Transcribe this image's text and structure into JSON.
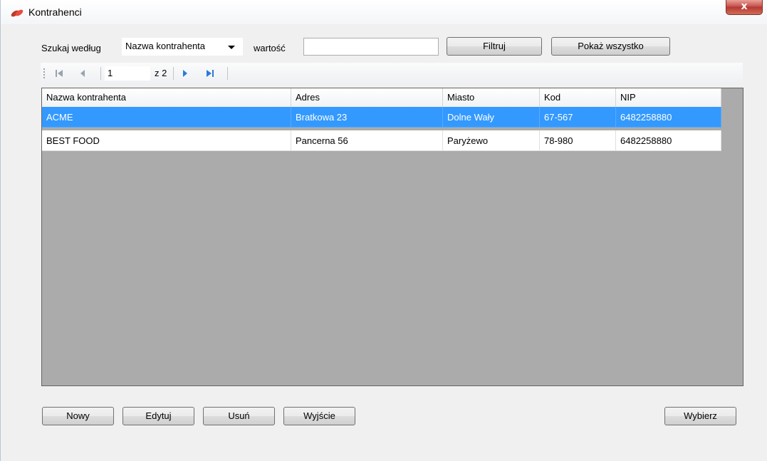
{
  "window": {
    "title": "Kontrahenci",
    "close_glyph": "x"
  },
  "search": {
    "label": "Szukaj według",
    "field_selected": "Nazwa kontrahenta",
    "value_label": "wartość",
    "value": "",
    "filter_button": "Filtruj",
    "show_all_button": "Pokaż wszystko"
  },
  "navigator": {
    "position": "1",
    "count_text": "z 2",
    "icons": [
      "move-first-icon",
      "move-previous-icon",
      "move-next-icon",
      "move-last-icon"
    ]
  },
  "grid": {
    "columns": [
      "Nazwa kontrahenta",
      "Adres",
      "Miasto",
      "Kod",
      "NIP"
    ],
    "rows": [
      {
        "selected": true,
        "cells": [
          "ACME",
          "Bratkowa 23",
          "Dolne Wały",
          "67-567",
          "6482258880"
        ]
      },
      {
        "selected": false,
        "cells": [
          "BEST FOOD",
          "Pancerna 56",
          "Paryżewo",
          "78-980",
          "6482258880"
        ]
      }
    ]
  },
  "actions": {
    "new": "Nowy",
    "edit": "Edytuj",
    "delete": "Usuń",
    "exit": "Wyjście",
    "select": "Wybierz"
  },
  "colors": {
    "selection": "#3399ff",
    "grid_background": "#ababab",
    "window_background": "#f0f0f0"
  }
}
